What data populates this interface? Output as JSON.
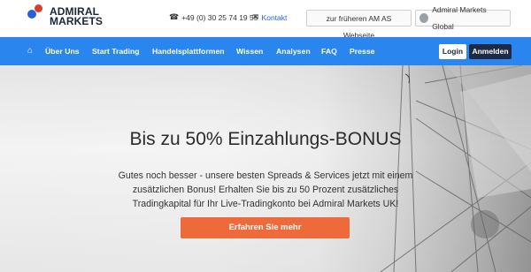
{
  "brand": {
    "line1": "ADMIRAL",
    "line2": "MARKETS"
  },
  "header": {
    "phone": "+49 (0) 30 25 74 19 55",
    "contact": "Kontakt",
    "old_site": "zur früheren AM AS Webseite",
    "global": "Admiral Markets Global"
  },
  "nav": {
    "items": [
      "Über Uns",
      "Start Trading",
      "Handelsplattformen",
      "Wissen",
      "Analysen",
      "FAQ",
      "Presse"
    ],
    "login": "Login",
    "register": "Anmelden"
  },
  "hero": {
    "title": "Bis zu 50% Einzahlungs-BONUS",
    "text": "Gutes noch besser - unsere besten Spreads & Services jetzt mit einem zusätzlichen Bonus! Erhalten Sie bis zu 50 Prozent zusätzliches Tradingkapital für Ihr Live-Tradingkonto bei Admiral Markets UK!",
    "cta": "Erfahren Sie mehr"
  },
  "icons": {
    "home": "home-icon",
    "phone": "phone-icon",
    "mail": "mail-icon",
    "globe": "globe-icon"
  },
  "colors": {
    "nav_bg": "#2a85ee",
    "cta_bg": "#ef6a3a",
    "register_bg": "#1d2a47",
    "logo_blue": "#2a62d6",
    "logo_red": "#e1392b"
  }
}
